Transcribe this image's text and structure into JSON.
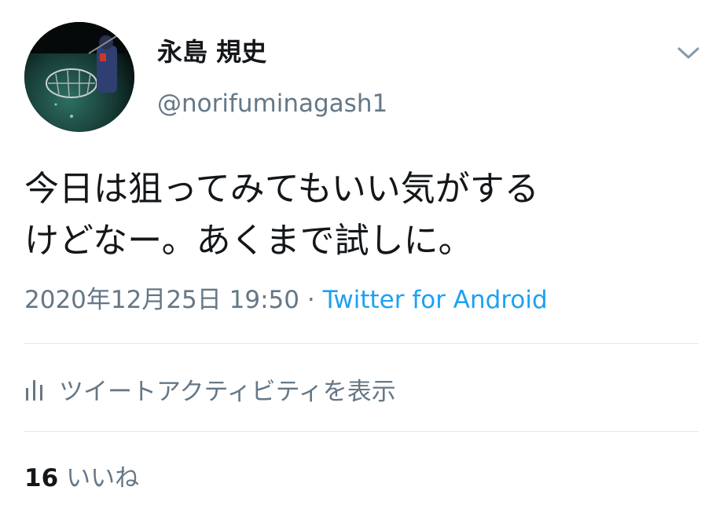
{
  "user": {
    "display_name": "永島 規史",
    "handle": "@norifuminagash1",
    "avatar_icon": "avatar-night-fishing-photo"
  },
  "tweet": {
    "text_line1": "今日は狙ってみてもいい気がする",
    "text_line2": "けどなー。あくまで試しに。",
    "date": "2020年12月25日 19:50",
    "separator": "·",
    "source": "Twitter for Android"
  },
  "actions": {
    "activity_label": "ツイートアクティビティを表示",
    "activity_icon": "bar-chart-icon",
    "menu_icon": "chevron-down-icon"
  },
  "stats": {
    "likes_count": "16",
    "likes_label": "いいね"
  },
  "colors": {
    "text": "#14171a",
    "secondary": "#657786",
    "link": "#1da1f2",
    "divider": "#e1e8ed"
  }
}
